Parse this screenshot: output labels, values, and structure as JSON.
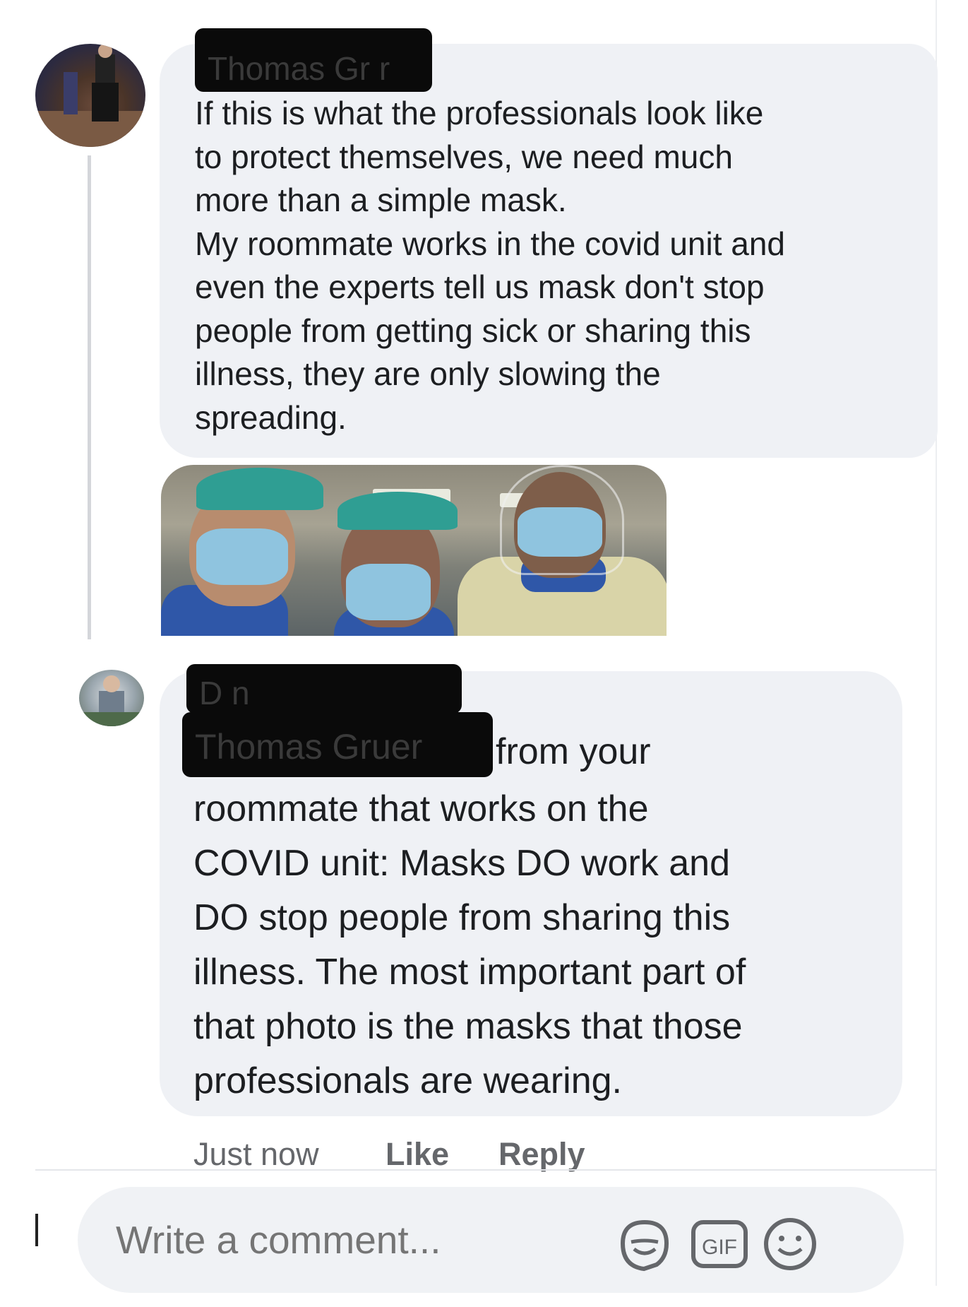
{
  "comment1": {
    "author_redacted": "Thomas Gr r",
    "text": "If this is what the professionals look like\nto protect themselves, we need much\nmore than a simple mask.\nMy roommate works in the covid unit and\neven the experts tell us mask don't stop\npeople from getting sick or sharing this\nillness, they are only slowing the\nspreading."
  },
  "comment2": {
    "author_redacted": "D n",
    "mention_redacted": "Thomas Gruer",
    "mention_tail": "from your",
    "text": "roommate that works on the\nCOVID unit: Masks DO work and\nDO stop people from sharing this\nillness. The most important part of\nthat photo is the masks that those\nprofessionals are wearing."
  },
  "actions": {
    "time": "Just now",
    "like": "Like",
    "reply": "Reply"
  },
  "composer": {
    "placeholder": "Write a comment...",
    "icons": [
      "sticker-icon",
      "gif-icon",
      "emoji-icon"
    ],
    "gif_label": "GIF"
  }
}
